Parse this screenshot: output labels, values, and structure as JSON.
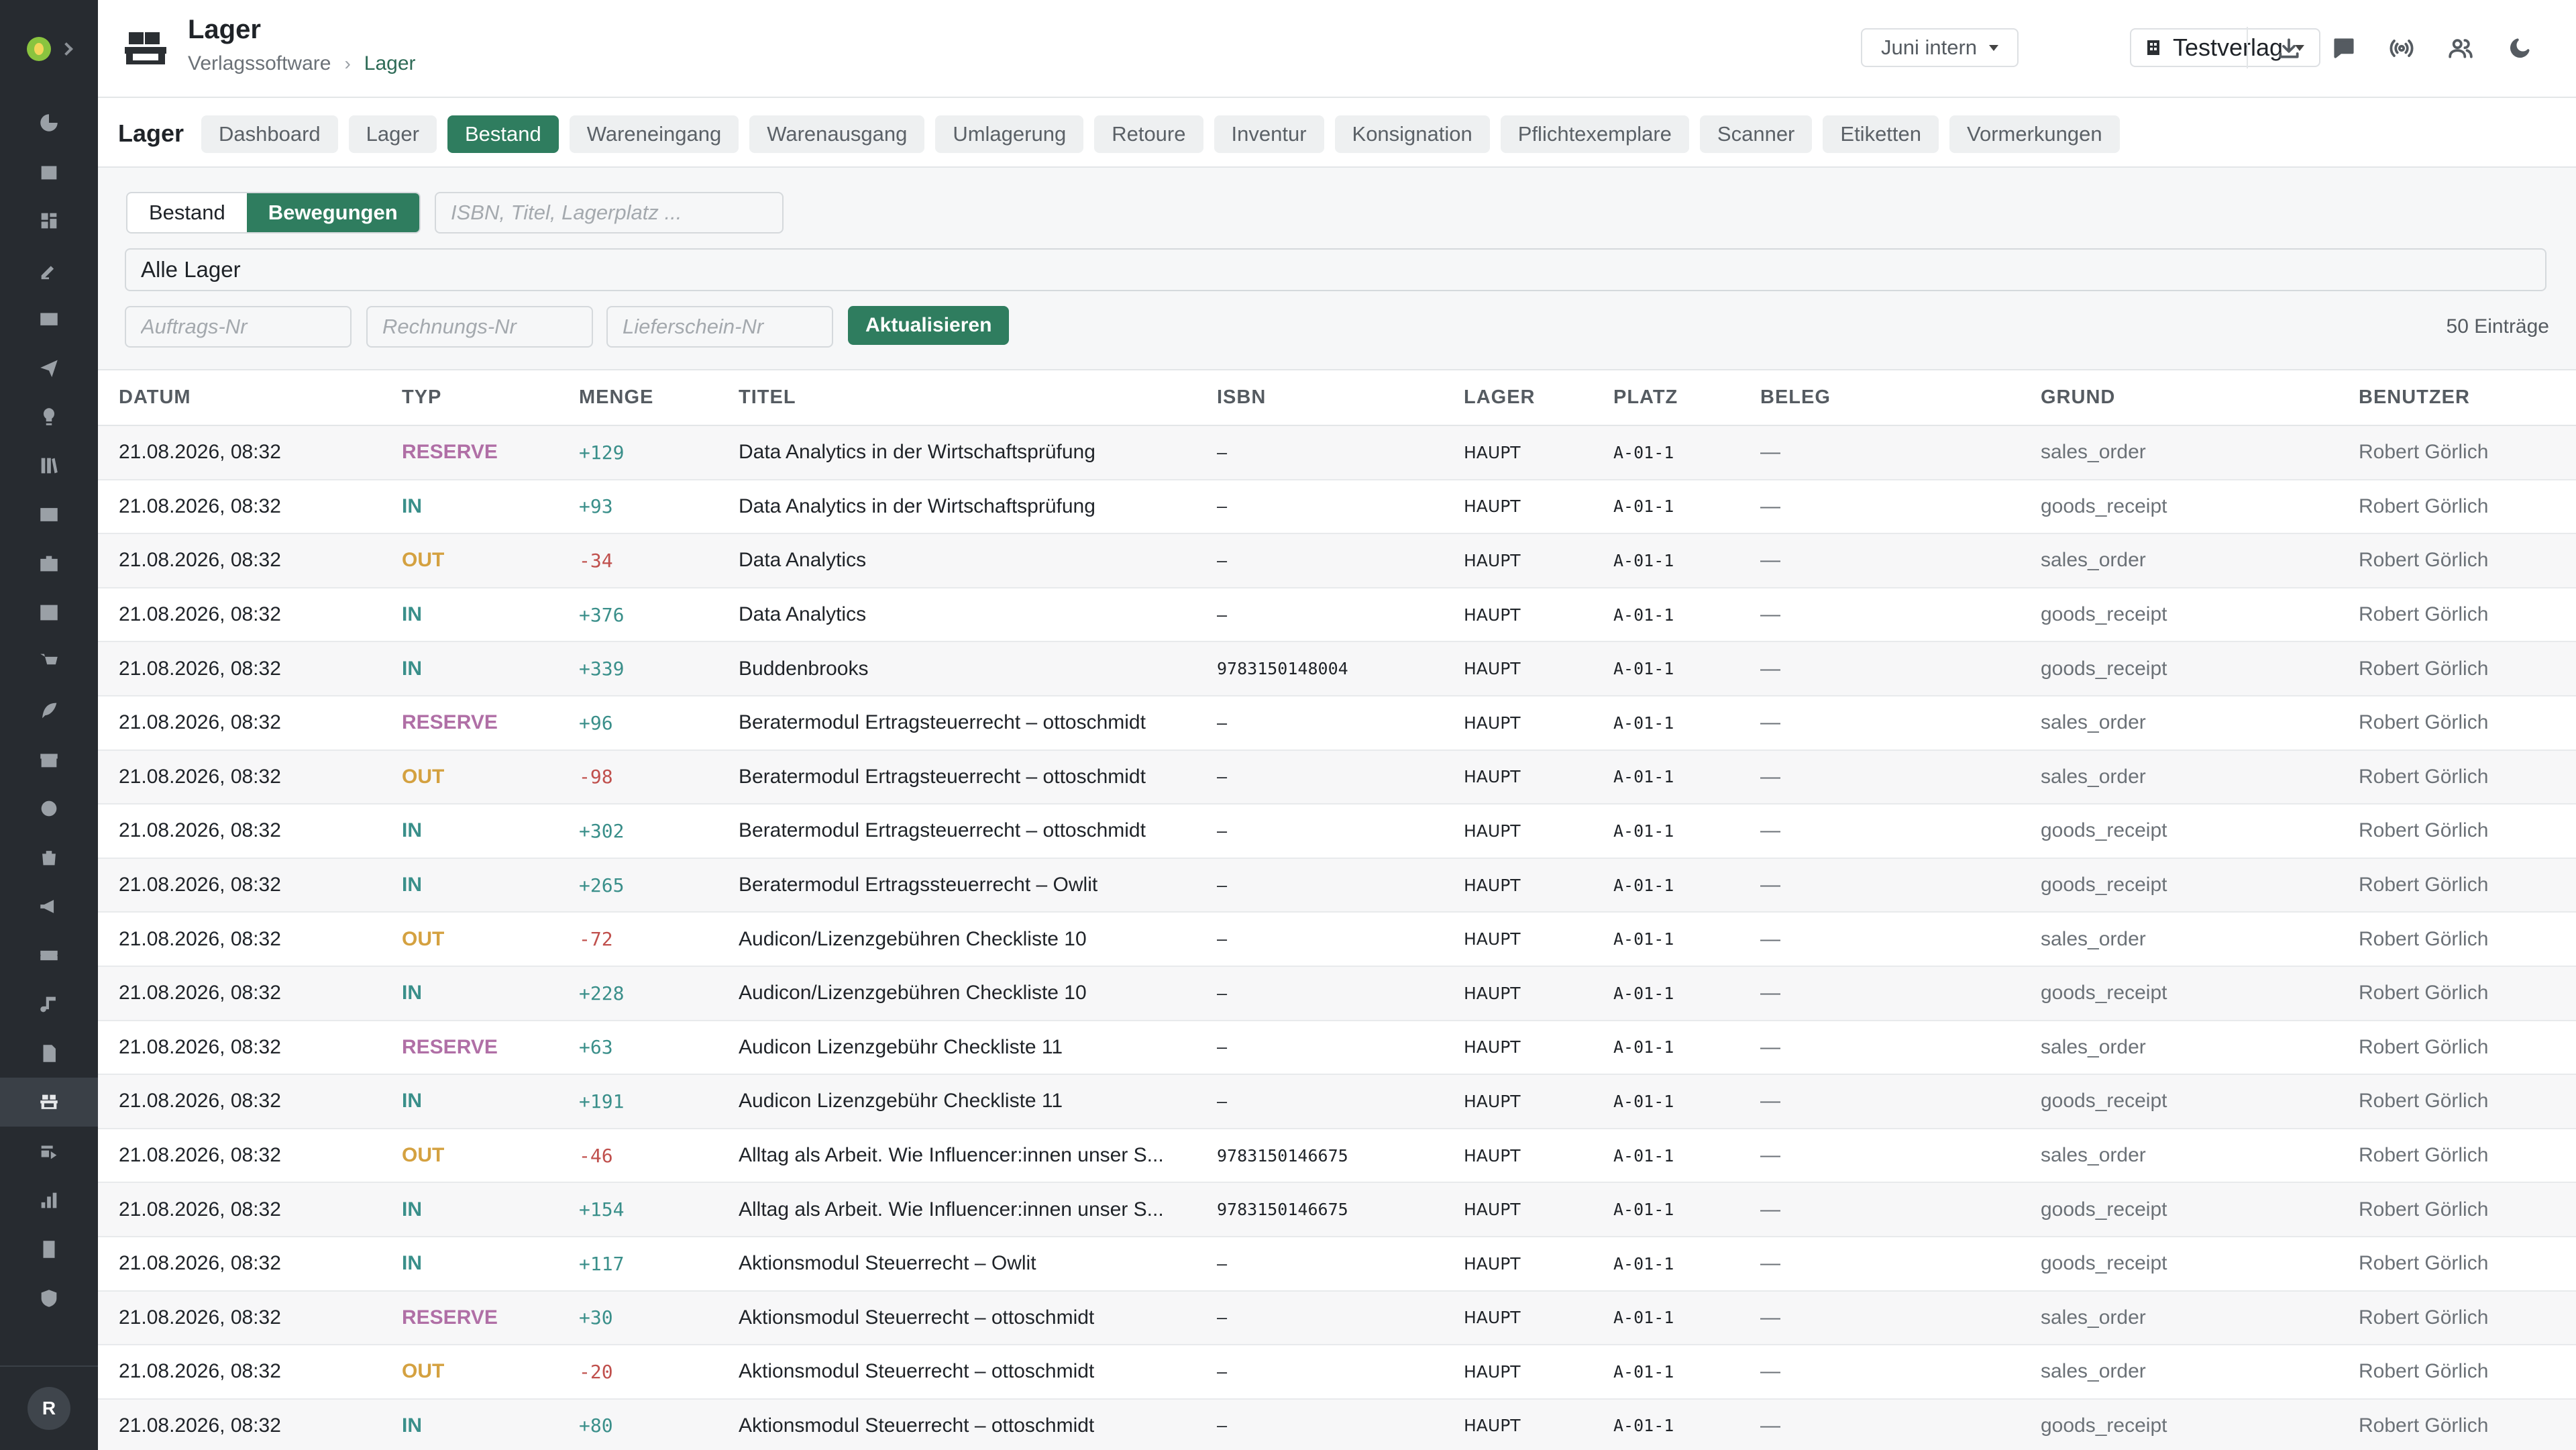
{
  "app": {
    "title": "Lager",
    "breadcrumb": [
      "Verlagssoftware",
      "Lager"
    ],
    "period_select": "Juni intern",
    "publisher_select": "Testverlag"
  },
  "sidebar": {
    "icons": [
      "dashboard-icon",
      "calendar-icon",
      "grid-icon",
      "edit-icon",
      "mail-icon",
      "send-icon",
      "lightbulb-icon",
      "library-icon",
      "image-icon",
      "briefcase-icon",
      "board-icon",
      "cart-icon",
      "feather-icon",
      "archive-icon",
      "circle-icon",
      "bag-icon",
      "megaphone-icon",
      "ticket-icon",
      "music-icon",
      "document-icon",
      "warehouse-icon",
      "transfer-icon",
      "bar-chart-icon",
      "report-icon",
      "shield-icon"
    ],
    "active_index": 20,
    "avatar": "R"
  },
  "module": {
    "title": "Lager",
    "tabs": [
      "Dashboard",
      "Lager",
      "Bestand",
      "Wareneingang",
      "Warenausgang",
      "Umlagerung",
      "Retoure",
      "Inventur",
      "Konsignation",
      "Pflichtexemplare",
      "Scanner",
      "Etiketten",
      "Vormerkungen"
    ],
    "active_tab": "Bestand"
  },
  "filters": {
    "segments": [
      "Bestand",
      "Bewegungen"
    ],
    "active_segment": "Bewegungen",
    "search_placeholder": "ISBN, Titel, Lagerplatz ...",
    "warehouse": "Alle Lager",
    "order_placeholder": "Auftrags-Nr",
    "invoice_placeholder": "Rechnungs-Nr",
    "delivery_placeholder": "Lieferschein-Nr",
    "refresh_label": "Aktualisieren",
    "count_label": "50 Einträge"
  },
  "table": {
    "columns": [
      "DATUM",
      "TYP",
      "MENGE",
      "TITEL",
      "ISBN",
      "LAGER",
      "PLATZ",
      "BELEG",
      "GRUND",
      "BENUTZER"
    ],
    "rows": [
      {
        "datum": "21.08.2026, 08:32",
        "typ": "RESERVE",
        "menge": "+129",
        "titel": "Data Analytics in der Wirtschaftsprüfung",
        "isbn": "–",
        "lager": "HAUPT",
        "platz": "A-01-1",
        "beleg": "—",
        "grund": "sales_order",
        "benutzer": "Robert Görlich"
      },
      {
        "datum": "21.08.2026, 08:32",
        "typ": "IN",
        "menge": "+93",
        "titel": "Data Analytics in der Wirtschaftsprüfung",
        "isbn": "–",
        "lager": "HAUPT",
        "platz": "A-01-1",
        "beleg": "—",
        "grund": "goods_receipt",
        "benutzer": "Robert Görlich"
      },
      {
        "datum": "21.08.2026, 08:32",
        "typ": "OUT",
        "menge": "-34",
        "titel": "Data Analytics",
        "isbn": "–",
        "lager": "HAUPT",
        "platz": "A-01-1",
        "beleg": "—",
        "grund": "sales_order",
        "benutzer": "Robert Görlich"
      },
      {
        "datum": "21.08.2026, 08:32",
        "typ": "IN",
        "menge": "+376",
        "titel": "Data Analytics",
        "isbn": "–",
        "lager": "HAUPT",
        "platz": "A-01-1",
        "beleg": "—",
        "grund": "goods_receipt",
        "benutzer": "Robert Görlich"
      },
      {
        "datum": "21.08.2026, 08:32",
        "typ": "IN",
        "menge": "+339",
        "titel": "Buddenbrooks",
        "isbn": "9783150148004",
        "lager": "HAUPT",
        "platz": "A-01-1",
        "beleg": "—",
        "grund": "goods_receipt",
        "benutzer": "Robert Görlich"
      },
      {
        "datum": "21.08.2026, 08:32",
        "typ": "RESERVE",
        "menge": "+96",
        "titel": "Beratermodul Ertragsteuerrecht – ottoschmidt",
        "isbn": "–",
        "lager": "HAUPT",
        "platz": "A-01-1",
        "beleg": "—",
        "grund": "sales_order",
        "benutzer": "Robert Görlich"
      },
      {
        "datum": "21.08.2026, 08:32",
        "typ": "OUT",
        "menge": "-98",
        "titel": "Beratermodul Ertragsteuerrecht – ottoschmidt",
        "isbn": "–",
        "lager": "HAUPT",
        "platz": "A-01-1",
        "beleg": "—",
        "grund": "sales_order",
        "benutzer": "Robert Görlich"
      },
      {
        "datum": "21.08.2026, 08:32",
        "typ": "IN",
        "menge": "+302",
        "titel": "Beratermodul Ertragsteuerrecht – ottoschmidt",
        "isbn": "–",
        "lager": "HAUPT",
        "platz": "A-01-1",
        "beleg": "—",
        "grund": "goods_receipt",
        "benutzer": "Robert Görlich"
      },
      {
        "datum": "21.08.2026, 08:32",
        "typ": "IN",
        "menge": "+265",
        "titel": "Beratermodul Ertragssteuerrecht – Owlit",
        "isbn": "–",
        "lager": "HAUPT",
        "platz": "A-01-1",
        "beleg": "—",
        "grund": "goods_receipt",
        "benutzer": "Robert Görlich"
      },
      {
        "datum": "21.08.2026, 08:32",
        "typ": "OUT",
        "menge": "-72",
        "titel": "Audicon/Lizenzgebühren Checkliste 10",
        "isbn": "–",
        "lager": "HAUPT",
        "platz": "A-01-1",
        "beleg": "—",
        "grund": "sales_order",
        "benutzer": "Robert Görlich"
      },
      {
        "datum": "21.08.2026, 08:32",
        "typ": "IN",
        "menge": "+228",
        "titel": "Audicon/Lizenzgebühren Checkliste 10",
        "isbn": "–",
        "lager": "HAUPT",
        "platz": "A-01-1",
        "beleg": "—",
        "grund": "goods_receipt",
        "benutzer": "Robert Görlich"
      },
      {
        "datum": "21.08.2026, 08:32",
        "typ": "RESERVE",
        "menge": "+63",
        "titel": "Audicon Lizenzgebühr Checkliste 11",
        "isbn": "–",
        "lager": "HAUPT",
        "platz": "A-01-1",
        "beleg": "—",
        "grund": "sales_order",
        "benutzer": "Robert Görlich"
      },
      {
        "datum": "21.08.2026, 08:32",
        "typ": "IN",
        "menge": "+191",
        "titel": "Audicon Lizenzgebühr Checkliste 11",
        "isbn": "–",
        "lager": "HAUPT",
        "platz": "A-01-1",
        "beleg": "—",
        "grund": "goods_receipt",
        "benutzer": "Robert Görlich"
      },
      {
        "datum": "21.08.2026, 08:32",
        "typ": "OUT",
        "menge": "-46",
        "titel": "Alltag als Arbeit. Wie Influencer:innen unser S...",
        "isbn": "9783150146675",
        "lager": "HAUPT",
        "platz": "A-01-1",
        "beleg": "—",
        "grund": "sales_order",
        "benutzer": "Robert Görlich"
      },
      {
        "datum": "21.08.2026, 08:32",
        "typ": "IN",
        "menge": "+154",
        "titel": "Alltag als Arbeit. Wie Influencer:innen unser S...",
        "isbn": "9783150146675",
        "lager": "HAUPT",
        "platz": "A-01-1",
        "beleg": "—",
        "grund": "goods_receipt",
        "benutzer": "Robert Görlich"
      },
      {
        "datum": "21.08.2026, 08:32",
        "typ": "IN",
        "menge": "+117",
        "titel": "Aktionsmodul Steuerrecht – Owlit",
        "isbn": "–",
        "lager": "HAUPT",
        "platz": "A-01-1",
        "beleg": "—",
        "grund": "goods_receipt",
        "benutzer": "Robert Görlich"
      },
      {
        "datum": "21.08.2026, 08:32",
        "typ": "RESERVE",
        "menge": "+30",
        "titel": "Aktionsmodul Steuerrecht – ottoschmidt",
        "isbn": "–",
        "lager": "HAUPT",
        "platz": "A-01-1",
        "beleg": "—",
        "grund": "sales_order",
        "benutzer": "Robert Görlich"
      },
      {
        "datum": "21.08.2026, 08:32",
        "typ": "OUT",
        "menge": "-20",
        "titel": "Aktionsmodul Steuerrecht – ottoschmidt",
        "isbn": "–",
        "lager": "HAUPT",
        "platz": "A-01-1",
        "beleg": "—",
        "grund": "sales_order",
        "benutzer": "Robert Görlich"
      },
      {
        "datum": "21.08.2026, 08:32",
        "typ": "IN",
        "menge": "+80",
        "titel": "Aktionsmodul Steuerrecht – ottoschmidt",
        "isbn": "–",
        "lager": "HAUPT",
        "platz": "A-01-1",
        "beleg": "—",
        "grund": "goods_receipt",
        "benutzer": "Robert Görlich"
      }
    ]
  },
  "colors": {
    "accent": "#2f7d5f",
    "sidebar_bg": "#272b30",
    "type_reserve": "#b06fa6",
    "type_in": "#3a8f8a",
    "type_out": "#d4a140",
    "negative": "#c0504d"
  }
}
